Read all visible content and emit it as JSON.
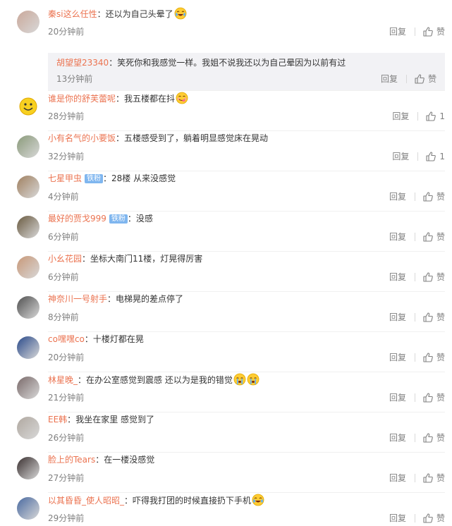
{
  "labels": {
    "reply": "回复",
    "like": "赞"
  },
  "comments": [
    {
      "user": "秦si这么任性",
      "text": "还以为自己头晕了",
      "time": "20分钟前",
      "likes": "赞",
      "emoji": [
        "cry-laugh"
      ],
      "avatar_color": "#caa89a",
      "sub": {
        "user": "胡望望23340",
        "text": "笑死你和我感觉一样。我姐不说我还以为自己晕因为以前有过",
        "time": "13分钟前",
        "likes": "赞"
      }
    },
    {
      "user": "谁是你的舒芙蕾呢",
      "text": "我五楼都在抖",
      "time": "28分钟前",
      "likes": "1",
      "emoji": [
        "yum"
      ],
      "avatar_color": "#f7d020"
    },
    {
      "user": "小有名气的小要饭",
      "text": "五楼感受到了，躺着明显感觉床在晃动",
      "time": "32分钟前",
      "likes": "1",
      "avatar_color": "#8a9a7a"
    },
    {
      "user": "七星甲虫",
      "badge": "铁粉",
      "text": "28楼 从来没感觉",
      "time": "4分钟前",
      "likes": "赞",
      "avatar_color": "#a08060"
    },
    {
      "user": "最好的贾戈999",
      "badge": "铁粉",
      "text": "没感",
      "time": "6分钟前",
      "likes": "赞",
      "avatar_color": "#6a5a40"
    },
    {
      "user": "小幺花园",
      "text": "坐标大南门11楼，灯晃得厉害",
      "time": "6分钟前",
      "likes": "赞",
      "avatar_color": "#c89878"
    },
    {
      "user": "神奈川一号射手",
      "text": "电梯晃的差点停了",
      "time": "8分钟前",
      "likes": "赞",
      "avatar_color": "#505050"
    },
    {
      "user": "co嘿嘿co",
      "text": "十楼灯都在晃",
      "time": "20分钟前",
      "likes": "赞",
      "avatar_color": "#2a4a8a"
    },
    {
      "user": "林星晚_",
      "text": "在办公室感觉到震感 还以为是我的错觉",
      "time": "21分钟前",
      "likes": "赞",
      "emoji": [
        "tears",
        "tears"
      ],
      "avatar_color": "#7a6a6a"
    },
    {
      "user": "EE韩",
      "text": "我坐在家里 感觉到了",
      "time": "26分钟前",
      "likes": "赞",
      "avatar_color": "#b0a8a0"
    },
    {
      "user": "脸上的Tears",
      "text": "在一楼没感觉",
      "time": "27分钟前",
      "likes": "赞",
      "avatar_color": "#3a3030"
    },
    {
      "user": "以其昏昏_使人昭昭_",
      "text": "吓得我打团的时候直接扔下手机",
      "time": "29分钟前",
      "likes": "赞",
      "emoji": [
        "cry-laugh"
      ],
      "avatar_color": "#4a6aa0"
    }
  ]
}
